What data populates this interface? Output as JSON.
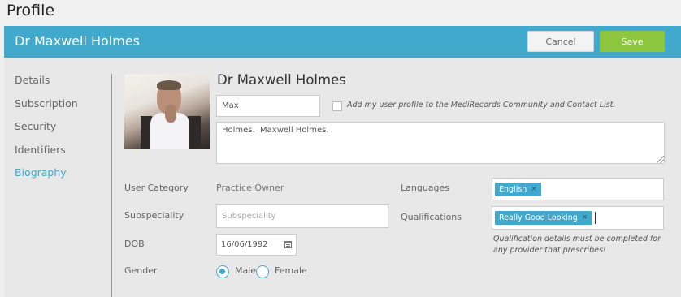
{
  "page": {
    "title": "Profile"
  },
  "header": {
    "name": "Dr Maxwell Holmes",
    "cancel_label": "Cancel",
    "save_label": "Save"
  },
  "sidebar": {
    "items": [
      {
        "label": "Details",
        "active": false
      },
      {
        "label": "Subscription",
        "active": false
      },
      {
        "label": "Security",
        "active": false
      },
      {
        "label": "Identifiers",
        "active": false
      },
      {
        "label": "Biography",
        "active": true
      }
    ]
  },
  "profile": {
    "display_name": "Dr Maxwell Holmes",
    "first_name": "Max",
    "community_checkbox_label": "Add my user profile to the MediRecords Community and Contact List.",
    "community_checked": false,
    "bio": "Holmes.  Maxwell Holmes."
  },
  "fields": {
    "user_category": {
      "label": "User Category",
      "value": "Practice Owner"
    },
    "subspeciality": {
      "label": "Subspeciality",
      "value": "",
      "placeholder": "Subspeciality"
    },
    "dob": {
      "label": "DOB",
      "value": "16/06/1992"
    },
    "gender": {
      "label": "Gender",
      "options": [
        "Male",
        "Female"
      ],
      "selected": "Male"
    },
    "languages": {
      "label": "Languages",
      "tags": [
        "English"
      ]
    },
    "qualifications": {
      "label": "Qualifications",
      "tags": [
        "Really Good Looking"
      ],
      "note": "Qualification details must be completed for any provider that prescribes!"
    }
  },
  "colors": {
    "accent": "#41a9cc",
    "save": "#8dc63f",
    "background": "#e8e8e8"
  },
  "icons": {
    "tag_remove": "close-icon",
    "date_picker": "calendar-icon",
    "tag_remove_glyph": "×"
  }
}
